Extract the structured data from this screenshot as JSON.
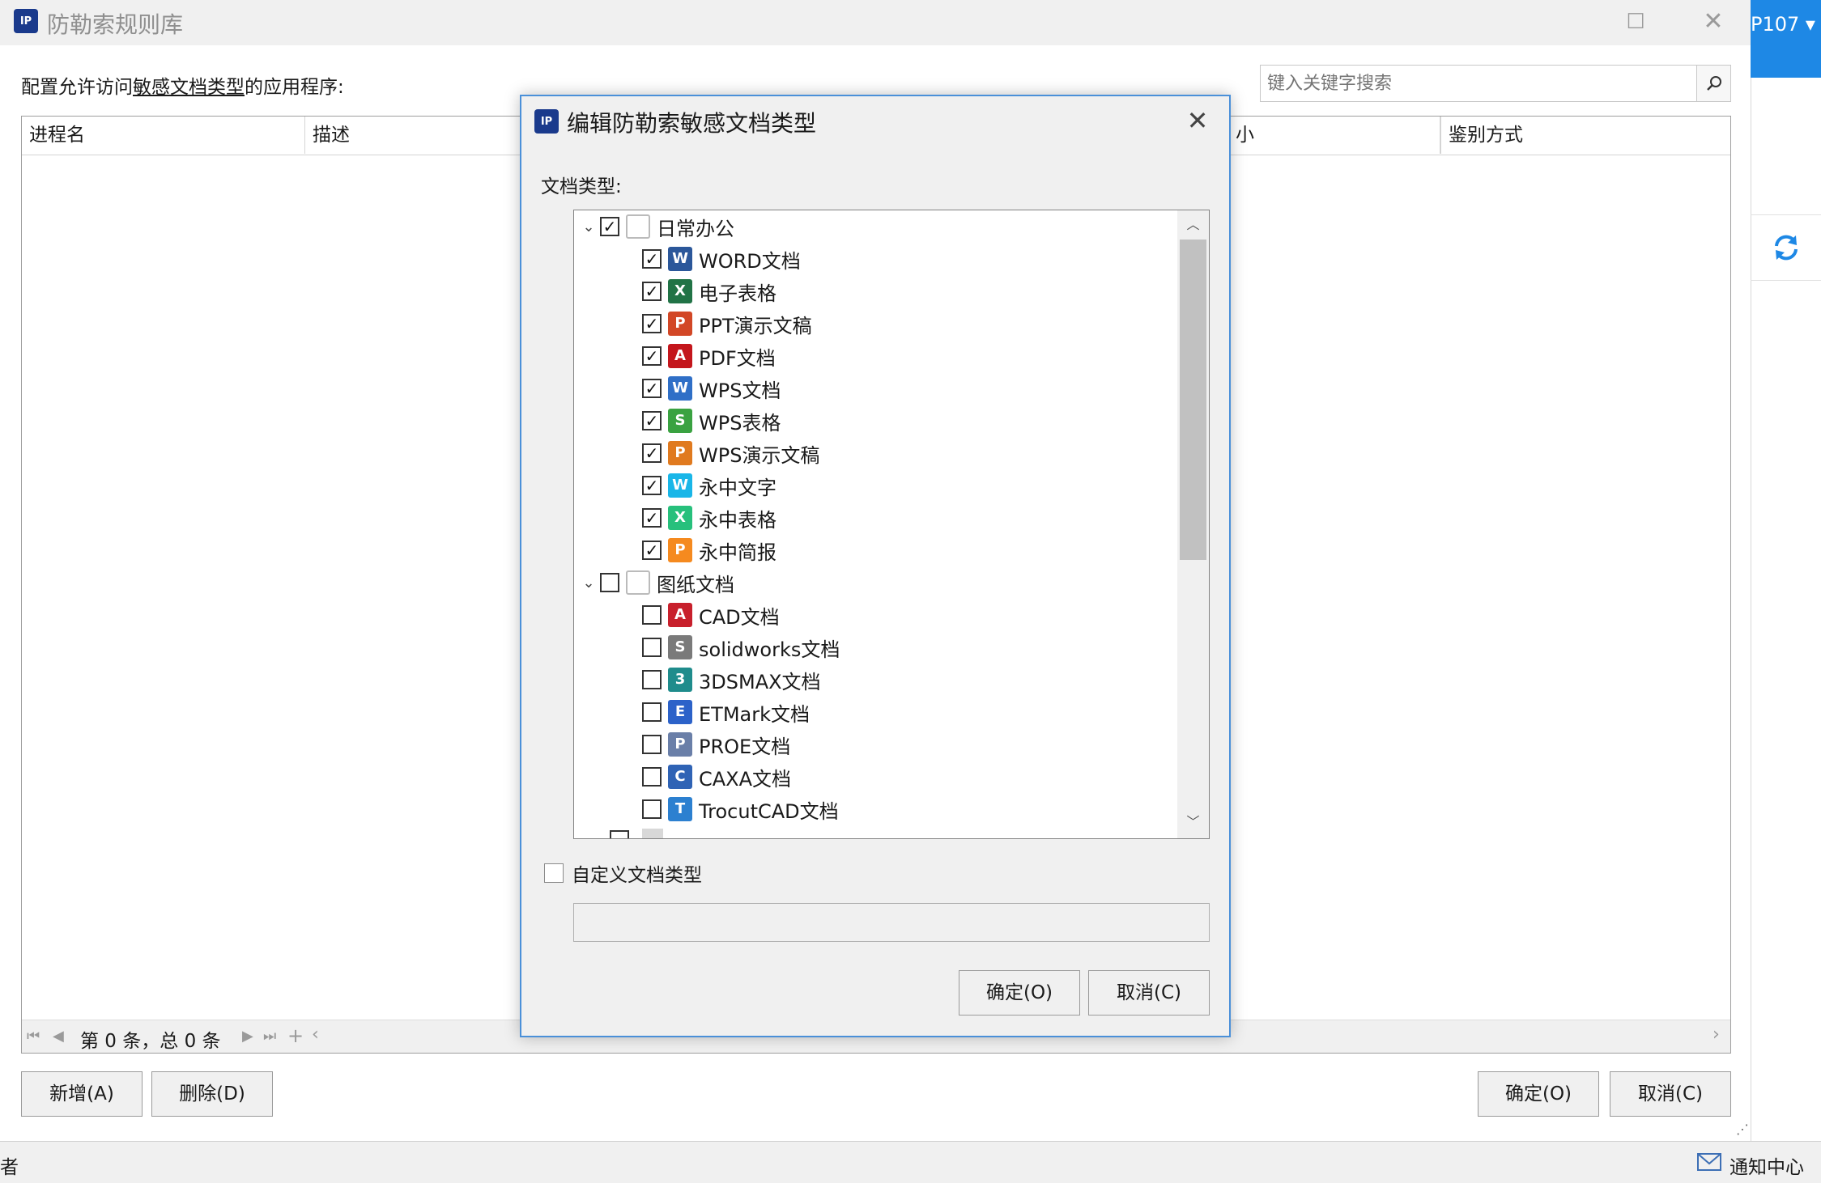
{
  "window": {
    "app_icon_text": "IP",
    "title": "防勒索规则库",
    "prompt_prefix": "配置允许访问",
    "prompt_link": "敏感文档类型",
    "prompt_suffix": "的应用程序:",
    "search_placeholder": "键入关键字搜索",
    "columns": [
      "进程名",
      "描述",
      "小",
      "鉴别方式"
    ],
    "pager_text": "第 0 条，总 0 条",
    "add_button": "新增(A)",
    "delete_button": "删除(D)",
    "ok_button": "确定(O)",
    "cancel_button": "取消(C)"
  },
  "side": {
    "tab_label": "P107 ▾",
    "refresh_icon": "refresh-icon"
  },
  "status": {
    "left_text": "者",
    "notify_label": "通知中心"
  },
  "dialog": {
    "title": "编辑防勒索敏感文档类型",
    "doc_type_label": "文档类型:",
    "groups": [
      {
        "label": "日常办公",
        "checked": true,
        "items": [
          {
            "label": "WORD文档",
            "checked": true,
            "icon": "W",
            "color": "#2b579a"
          },
          {
            "label": "电子表格",
            "checked": true,
            "icon": "X",
            "color": "#217346"
          },
          {
            "label": "PPT演示文稿",
            "checked": true,
            "icon": "P",
            "color": "#d24726"
          },
          {
            "label": "PDF文档",
            "checked": true,
            "icon": "A",
            "color": "#c4161c"
          },
          {
            "label": "WPS文档",
            "checked": true,
            "icon": "W",
            "color": "#2f6fc7"
          },
          {
            "label": "WPS表格",
            "checked": true,
            "icon": "S",
            "color": "#3aa241"
          },
          {
            "label": "WPS演示文稿",
            "checked": true,
            "icon": "P",
            "color": "#e07a1f"
          },
          {
            "label": "永中文字",
            "checked": true,
            "icon": "W",
            "color": "#19b6e8"
          },
          {
            "label": "永中表格",
            "checked": true,
            "icon": "X",
            "color": "#27c07c"
          },
          {
            "label": "永中简报",
            "checked": true,
            "icon": "P",
            "color": "#f58a1f"
          }
        ]
      },
      {
        "label": "图纸文档",
        "checked": false,
        "items": [
          {
            "label": "CAD文档",
            "checked": false,
            "icon": "A",
            "color": "#c8202c"
          },
          {
            "label": "solidworks文档",
            "checked": false,
            "icon": "S",
            "color": "#7a7a7a"
          },
          {
            "label": "3DSMAX文档",
            "checked": false,
            "icon": "3",
            "color": "#1f8c8c"
          },
          {
            "label": "ETMark文档",
            "checked": false,
            "icon": "E",
            "color": "#2c62c9"
          },
          {
            "label": "PROE文档",
            "checked": false,
            "icon": "P",
            "color": "#6a7fa8"
          },
          {
            "label": "CAXA文档",
            "checked": false,
            "icon": "C",
            "color": "#2f63b5"
          },
          {
            "label": "TrocutCAD文档",
            "checked": false,
            "icon": "T",
            "color": "#2c80d0"
          }
        ]
      }
    ],
    "custom_type_label": "自定义文档类型",
    "custom_type_value": "",
    "ok_button": "确定(O)",
    "cancel_button": "取消(C)"
  }
}
